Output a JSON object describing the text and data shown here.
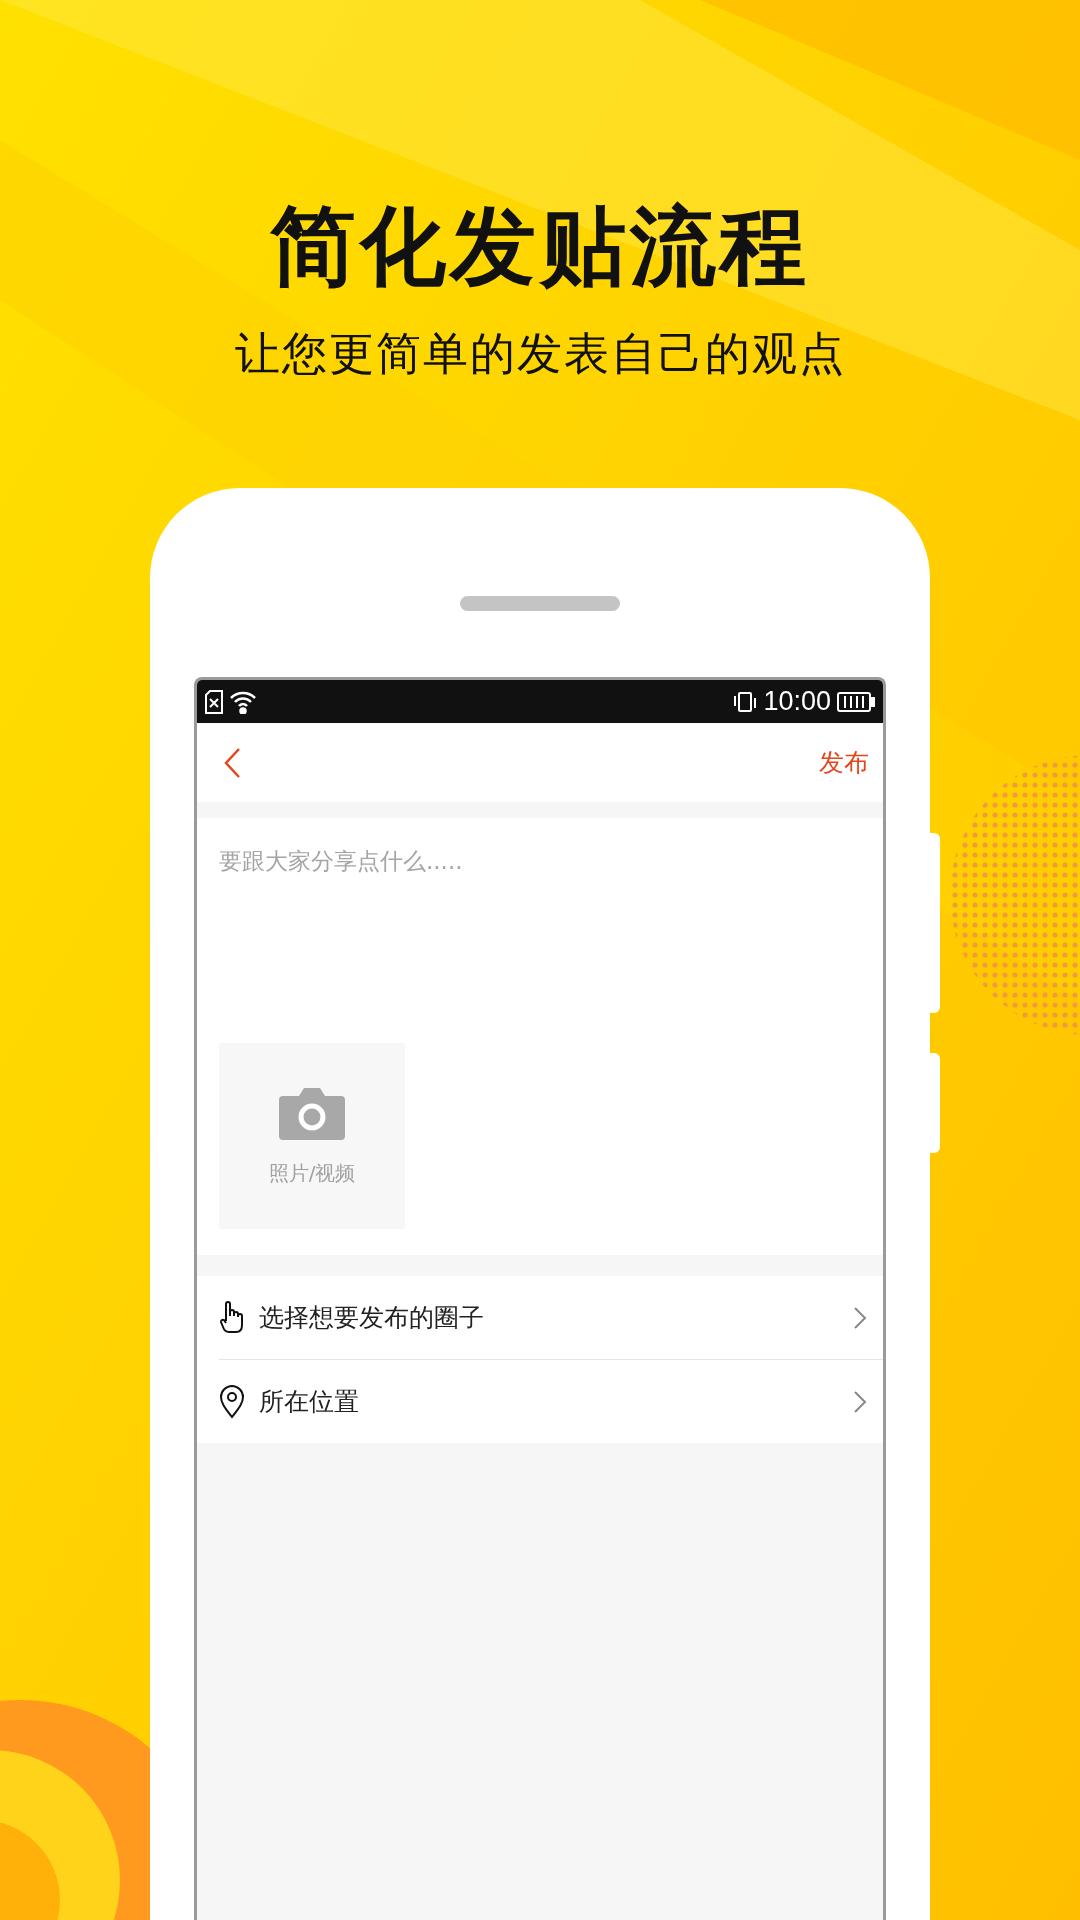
{
  "page": {
    "title": "简化发贴流程",
    "subtitle": "让您更简单的发表自己的观点"
  },
  "status_bar": {
    "time": "10:00"
  },
  "header": {
    "publish": "发布"
  },
  "composer": {
    "placeholder": "要跟大家分享点什么.....",
    "media_label": "照片/视频"
  },
  "options": [
    {
      "kind": "circle",
      "label": "选择想要发布的圈子"
    },
    {
      "kind": "location",
      "label": "所在位置"
    }
  ]
}
